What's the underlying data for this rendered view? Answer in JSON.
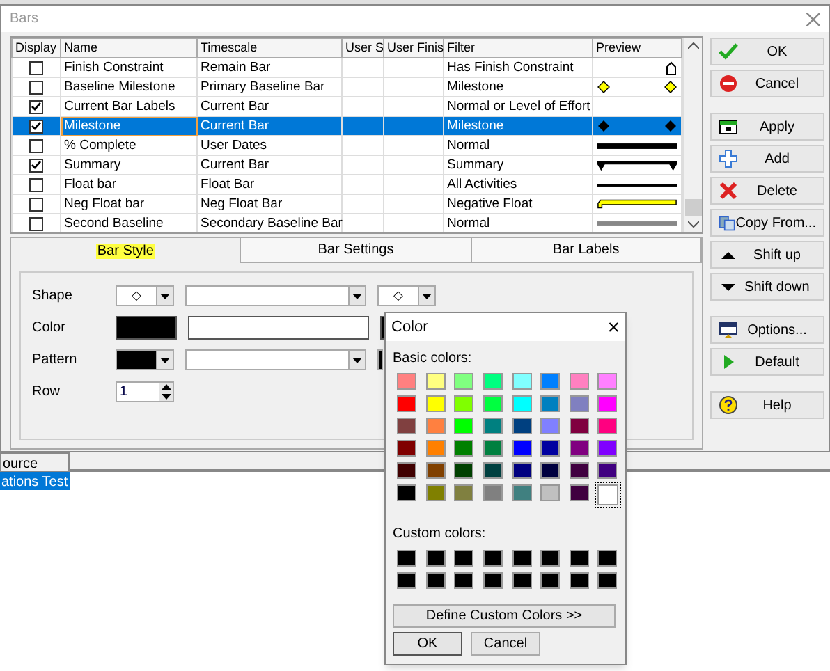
{
  "window": {
    "title": "Bars"
  },
  "table": {
    "columns": [
      "Display",
      "Name",
      "Timescale",
      "User S",
      "User Finis",
      "Filter",
      "Preview"
    ],
    "rows": [
      {
        "display": false,
        "name": "Finish Constraint",
        "timescale": "Remain Bar",
        "filter": "Has Finish Constraint",
        "kind": "finish-marker",
        "selected": false
      },
      {
        "display": false,
        "name": "Baseline Milestone",
        "timescale": "Primary Baseline Bar",
        "filter": "Milestone",
        "kind": "yellow-diamonds",
        "selected": false
      },
      {
        "display": true,
        "name": "Current Bar Labels",
        "timescale": "Current Bar",
        "filter": "Normal or Level of Effort",
        "kind": "none",
        "selected": false
      },
      {
        "display": true,
        "name": "Milestone",
        "timescale": "Current Bar",
        "filter": "Milestone",
        "kind": "diamonds",
        "selected": true
      },
      {
        "display": false,
        "name": "% Complete",
        "timescale": "User Dates",
        "filter": "Normal",
        "kind": "thick",
        "selected": false
      },
      {
        "display": true,
        "name": "Summary",
        "timescale": "Current Bar",
        "filter": "Summary",
        "kind": "summary",
        "selected": false
      },
      {
        "display": false,
        "name": "Float bar",
        "timescale": "Float Bar",
        "filter": "All Activities",
        "kind": "thin",
        "selected": false
      },
      {
        "display": false,
        "name": "Neg Float bar",
        "timescale": "Neg Float Bar",
        "filter": "Negative Float",
        "kind": "float",
        "selected": false
      },
      {
        "display": false,
        "name": "Second Baseline",
        "timescale": "Secondary Baseline Bar",
        "filter": "Normal",
        "kind": "baseline",
        "selected": false
      }
    ]
  },
  "buttons": [
    "OK",
    "Cancel",
    "Apply",
    "Add",
    "Delete",
    "Copy From...",
    "Shift up",
    "Shift down",
    "Options...",
    "Default",
    "Help"
  ],
  "tabs": [
    {
      "label": "Bar Style",
      "selected": true
    },
    {
      "label": "Bar Settings",
      "selected": false
    },
    {
      "label": "Bar Labels",
      "selected": false
    }
  ],
  "bar_style": {
    "shape_label": "Shape",
    "shape_symbol": "◇",
    "end_symbol": "◇",
    "color_label": "Color",
    "pattern_label": "Pattern",
    "row_label": "Row",
    "row_value": "1"
  },
  "background": {
    "cells": [
      {
        "text": "ource",
        "selected": false
      },
      {
        "text": "ations Test",
        "selected": true
      }
    ]
  },
  "color_dialog": {
    "title": "Color",
    "close": "×",
    "basic_label": "Basic colors:",
    "basic": [
      {
        "color": "#ff8080",
        "selected": false
      },
      {
        "color": "#ffff80",
        "selected": false
      },
      {
        "color": "#80ff80",
        "selected": false
      },
      {
        "color": "#00ff80",
        "selected": false
      },
      {
        "color": "#80ffff",
        "selected": false
      },
      {
        "color": "#0080ff",
        "selected": false
      },
      {
        "color": "#ff80c0",
        "selected": false
      },
      {
        "color": "#ff80ff",
        "selected": false
      },
      {
        "color": "#ff0000",
        "selected": false
      },
      {
        "color": "#ffff00",
        "selected": false
      },
      {
        "color": "#80ff00",
        "selected": false
      },
      {
        "color": "#00ff40",
        "selected": false
      },
      {
        "color": "#00ffff",
        "selected": false
      },
      {
        "color": "#0080c0",
        "selected": false
      },
      {
        "color": "#8080c0",
        "selected": false
      },
      {
        "color": "#ff00ff",
        "selected": false
      },
      {
        "color": "#804040",
        "selected": false
      },
      {
        "color": "#ff8040",
        "selected": false
      },
      {
        "color": "#00ff00",
        "selected": false
      },
      {
        "color": "#008080",
        "selected": false
      },
      {
        "color": "#004080",
        "selected": false
      },
      {
        "color": "#8080ff",
        "selected": false
      },
      {
        "color": "#800040",
        "selected": false
      },
      {
        "color": "#ff0080",
        "selected": false
      },
      {
        "color": "#800000",
        "selected": false
      },
      {
        "color": "#ff8000",
        "selected": false
      },
      {
        "color": "#008000",
        "selected": false
      },
      {
        "color": "#008040",
        "selected": false
      },
      {
        "color": "#0000ff",
        "selected": false
      },
      {
        "color": "#0000a0",
        "selected": false
      },
      {
        "color": "#800080",
        "selected": false
      },
      {
        "color": "#8000ff",
        "selected": false
      },
      {
        "color": "#400000",
        "selected": false
      },
      {
        "color": "#804000",
        "selected": false
      },
      {
        "color": "#004000",
        "selected": false
      },
      {
        "color": "#004040",
        "selected": false
      },
      {
        "color": "#000080",
        "selected": false
      },
      {
        "color": "#000040",
        "selected": false
      },
      {
        "color": "#400040",
        "selected": false
      },
      {
        "color": "#400080",
        "selected": false
      },
      {
        "color": "#000000",
        "selected": false
      },
      {
        "color": "#808000",
        "selected": false
      },
      {
        "color": "#808040",
        "selected": false
      },
      {
        "color": "#808080",
        "selected": false
      },
      {
        "color": "#408080",
        "selected": false
      },
      {
        "color": "#c0c0c0",
        "selected": false
      },
      {
        "color": "#400040",
        "selected": false
      },
      {
        "color": "#ffffff",
        "selected": true
      }
    ],
    "custom_label": "Custom colors:",
    "custom": [
      {
        "color": "#000000"
      },
      {
        "color": "#000000"
      },
      {
        "color": "#000000"
      },
      {
        "color": "#000000"
      },
      {
        "color": "#000000"
      },
      {
        "color": "#000000"
      },
      {
        "color": "#000000"
      },
      {
        "color": "#000000"
      },
      {
        "color": "#000000"
      },
      {
        "color": "#000000"
      },
      {
        "color": "#000000"
      },
      {
        "color": "#000000"
      },
      {
        "color": "#000000"
      },
      {
        "color": "#000000"
      },
      {
        "color": "#000000"
      },
      {
        "color": "#000000"
      }
    ],
    "define_button": "Define Custom Colors >>",
    "ok": "OK",
    "cancel": "Cancel"
  }
}
